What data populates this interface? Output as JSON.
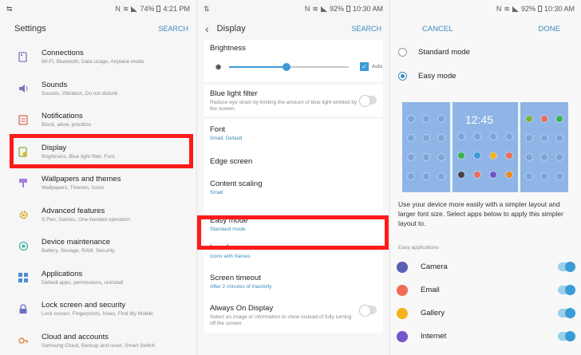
{
  "colors": {
    "accent": "#3b8bbf",
    "highlight": "#ff1a1a",
    "icon": "#8a6fbf"
  },
  "p1": {
    "status": {
      "time": "4:21 PM",
      "battery": "74%"
    },
    "title": "Settings",
    "search": "SEARCH",
    "items": [
      {
        "title": "Connections",
        "sub": "Wi-Fi, Bluetooth, Data usage, Airplane mode",
        "icon": "connections-icon"
      },
      {
        "title": "Sounds",
        "sub": "Sounds, Vibration, Do not disturb",
        "icon": "sound-icon"
      },
      {
        "title": "Notifications",
        "sub": "Block, allow, prioritize",
        "icon": "notifications-icon"
      },
      {
        "title": "Display",
        "sub": "Brightness, Blue light filter, Font",
        "icon": "display-icon"
      },
      {
        "title": "Wallpapers and themes",
        "sub": "Wallpapers, Themes, Icons",
        "icon": "brush-icon"
      },
      {
        "title": "Advanced features",
        "sub": "S Pen, Games, One-handed operation",
        "icon": "gear-icon"
      },
      {
        "title": "Device maintenance",
        "sub": "Battery, Storage, RAM, Security",
        "icon": "maintenance-icon"
      },
      {
        "title": "Applications",
        "sub": "Default apps, permissions, uninstall",
        "icon": "apps-icon"
      },
      {
        "title": "Lock screen and security",
        "sub": "Lock screen, Fingerprints, Irises, Find My Mobile",
        "icon": "lock-icon"
      },
      {
        "title": "Cloud and accounts",
        "sub": "Samsung Cloud, Backup and reset, Smart Switch",
        "icon": "key-icon"
      }
    ]
  },
  "p2": {
    "status": {
      "time": "10:30 AM",
      "battery": "92%"
    },
    "title": "Display",
    "search": "SEARCH",
    "brightness": {
      "label": "Brightness",
      "auto": "Auto",
      "level": 0.48
    },
    "blue_light": {
      "title": "Blue light filter",
      "desc": "Reduce eye strain by limiting the amount of blue light emitted by the screen."
    },
    "font": {
      "title": "Font",
      "sub": "Small, Default"
    },
    "edge": {
      "title": "Edge screen"
    },
    "scaling": {
      "title": "Content scaling",
      "sub": "Small"
    },
    "easy": {
      "title": "Easy mode",
      "sub": "Standard mode"
    },
    "frames": {
      "title": "Icon frames",
      "sub": "Icons with frames"
    },
    "timeout": {
      "title": "Screen timeout",
      "sub": "After 2 minutes of inactivity"
    },
    "aod": {
      "title": "Always On Display",
      "desc": "Select an image or information to show instead of fully turning off the screen."
    }
  },
  "p3": {
    "status": {
      "battery": "92%",
      "time": "10:30 AM"
    },
    "cancel": "CANCEL",
    "done": "DONE",
    "standard": "Standard mode",
    "easy": "Easy mode",
    "preview_time": "12:45",
    "desc": "Use your device more easily with a simpler layout and larger font size. Select apps below to apply this simpler layout to.",
    "apps_header": "Easy applications",
    "apps": [
      {
        "name": "Camera",
        "color": "#5a5fb5"
      },
      {
        "name": "Email",
        "color": "#ef6b5a"
      },
      {
        "name": "Gallery",
        "color": "#f5b21c"
      },
      {
        "name": "Internet",
        "color": "#7456c9"
      }
    ]
  }
}
